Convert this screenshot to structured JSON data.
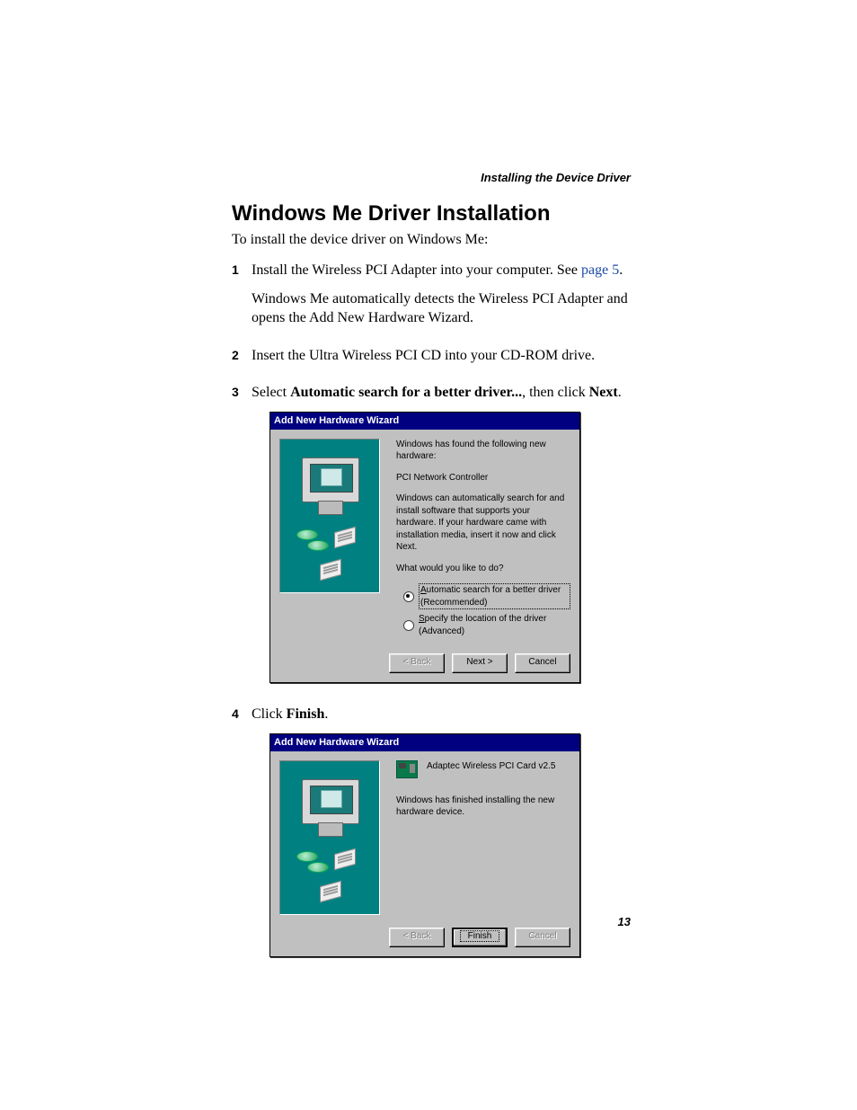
{
  "running_head": "Installing the Device Driver",
  "section_title": "Windows Me Driver Installation",
  "intro": "To install the device driver on Windows Me:",
  "steps": {
    "s1": {
      "num": "1",
      "text_a": "Install the Wireless PCI Adapter into your computer. See ",
      "link": "page 5",
      "text_b": ".",
      "para2": "Windows Me automatically detects the Wireless PCI Adapter and opens the Add New Hardware Wizard."
    },
    "s2": {
      "num": "2",
      "text": "Insert the Ultra Wireless PCI CD into your CD-ROM drive."
    },
    "s3": {
      "num": "3",
      "text_a": "Select ",
      "bold": "Automatic search for a better driver...",
      "text_b": ", then click ",
      "bold2": "Next",
      "text_c": "."
    },
    "s4": {
      "num": "4",
      "text_a": "Click ",
      "bold": "Finish",
      "text_b": "."
    }
  },
  "dialog1": {
    "title": "Add New Hardware Wizard",
    "found": "Windows has found the following new hardware:",
    "device": "PCI Network Controller",
    "desc": "Windows can automatically search for and install software that supports your hardware. If your hardware came with installation media, insert it now and click Next.",
    "prompt": "What would you like to do?",
    "opt1_a": "A",
    "opt1_b": "utomatic search for a better driver (Recommended)",
    "opt2_a": "S",
    "opt2_b": "pecify the location of the driver (Advanced)",
    "back": "< Back",
    "next": "Next >",
    "cancel": "Cancel"
  },
  "dialog2": {
    "title": "Add New Hardware Wizard",
    "device": "Adaptec Wireless PCI Card v2.5",
    "done": "Windows has finished installing the new hardware device.",
    "back": "< Back",
    "finish": "Finish",
    "cancel": "Cancel"
  },
  "page_number": "13"
}
